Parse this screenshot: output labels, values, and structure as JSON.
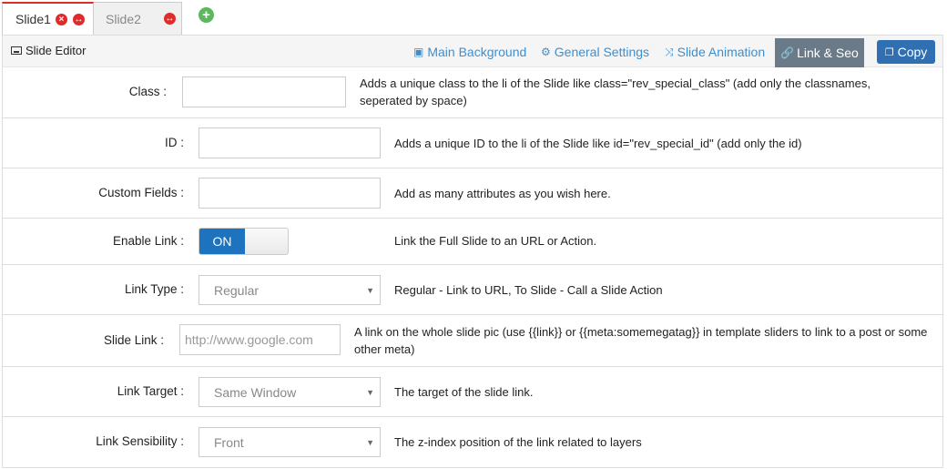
{
  "tabs": {
    "slide1": "Slide1",
    "slide2": "Slide2",
    "delete_glyph": "×",
    "duplicate_glyph": "↔",
    "add_glyph": "+"
  },
  "editor": {
    "title": "Slide Editor",
    "tabs": {
      "main_background": "Main Background",
      "general_settings": "General Settings",
      "slide_animation": "Slide Animation",
      "link_seo": "Link & Seo"
    },
    "copy_label": "Copy",
    "active_tab_color": "#6b7a88",
    "accent": "#3a8fd3"
  },
  "fields": {
    "class": {
      "label": "Class :",
      "value": "",
      "desc": "Adds a unique class to the li of the Slide like class=\"rev_special_class\" (add only the classnames, seperated by space)"
    },
    "id": {
      "label": "ID :",
      "value": "",
      "desc": "Adds a unique ID to the li of the Slide like id=\"rev_special_id\" (add only the id)"
    },
    "custom_fields": {
      "label": "Custom Fields :",
      "value": "",
      "desc": "Add as many attributes as you wish here."
    },
    "enable_link": {
      "label": "Enable Link :",
      "state": "ON",
      "desc": "Link the Full Slide to an URL or Action."
    },
    "link_type": {
      "label": "Link Type :",
      "selected": "Regular",
      "desc": "Regular - Link to URL, To Slide - Call a Slide Action"
    },
    "slide_link": {
      "label": "Slide Link :",
      "placeholder": "http://www.google.com",
      "desc": "A link on the whole slide pic (use {{link}} or {{meta:somemegatag}} in template sliders to link to a post or some other meta)"
    },
    "link_target": {
      "label": "Link Target :",
      "selected": "Same Window",
      "desc": "The target of the slide link."
    },
    "link_sensibility": {
      "label": "Link Sensibility :",
      "selected": "Front",
      "desc": "The z-index position of the link related to layers"
    }
  }
}
